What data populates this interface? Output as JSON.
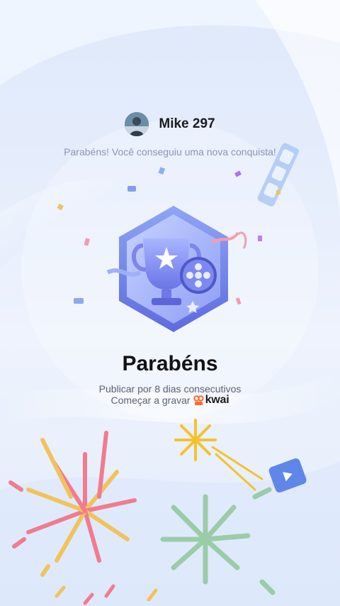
{
  "user": {
    "name": "Mike 297"
  },
  "subtitle": "Parabéns! Você conseguiu uma nova conquista!",
  "achievement": {
    "title": "Parabéns",
    "line1": "Publicar por 8 dias consecutivos",
    "line2_prefix": "Começar a gravar",
    "brand": "kwai"
  },
  "icons": {
    "avatar": "user-avatar",
    "badge": "trophy-film-reel-hexagon-badge",
    "brand_logo": "kwai-logo"
  },
  "colors": {
    "accent": "#6f7df0",
    "brand": "#ff6a2b",
    "title": "#121216",
    "subtitle": "#8c97ad"
  }
}
